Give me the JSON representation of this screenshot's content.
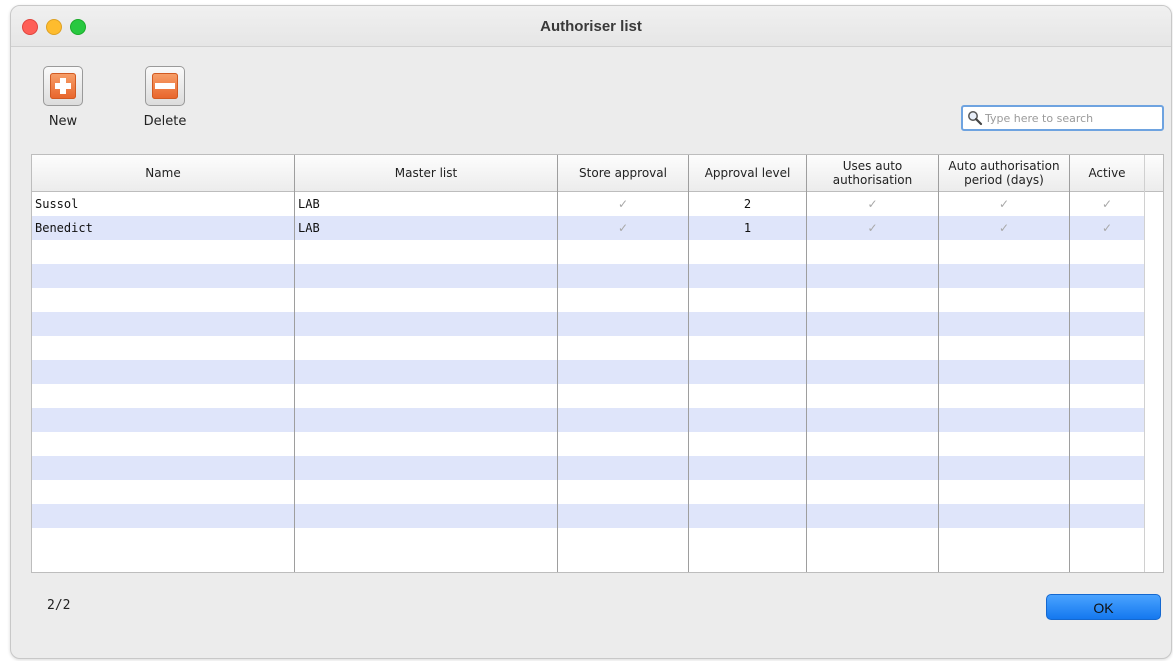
{
  "window": {
    "title": "Authoriser list"
  },
  "toolbar": {
    "new_label": "New",
    "delete_label": "Delete"
  },
  "search": {
    "placeholder": "Type here to search",
    "value": ""
  },
  "table": {
    "headers": {
      "name": "Name",
      "master_list": "Master list",
      "store_approval": "Store approval",
      "approval_level": "Approval level",
      "uses_auto_line1": "Uses auto",
      "uses_auto_line2": "authorisation",
      "auto_period_line1": "Auto authorisation",
      "auto_period_line2": "period (days)",
      "active": "Active"
    },
    "rows": [
      {
        "name": "Sussol",
        "master_list": "LAB",
        "store_approval": true,
        "approval_level": "2",
        "uses_auto_authorisation": true,
        "auto_authorisation_period": true,
        "active": true
      },
      {
        "name": "Benedict",
        "master_list": "LAB",
        "store_approval": true,
        "approval_level": "1",
        "uses_auto_authorisation": true,
        "auto_authorisation_period": true,
        "active": true
      }
    ],
    "check_glyph": "✓"
  },
  "footer": {
    "record_count": "2/2",
    "ok_label": "OK"
  },
  "colors": {
    "accent": "#1478ef",
    "stripe": "#dfe5fa",
    "tool_orange": "#e8642a"
  }
}
